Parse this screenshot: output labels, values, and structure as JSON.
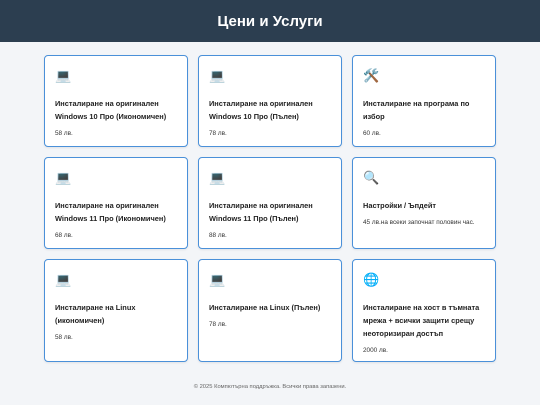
{
  "header": {
    "title": "Цени и Услуги"
  },
  "services": [
    {
      "icon": "laptop-icon",
      "glyph": "💻",
      "title": "Инсталиране на оригинален Windows 10 Про (Икономичен)",
      "price": "58 лв."
    },
    {
      "icon": "laptop-icon",
      "glyph": "💻",
      "title": "Инсталиране на оригинален Windows 10 Про (Пълен)",
      "price": "78 лв."
    },
    {
      "icon": "tools-icon",
      "glyph": "🛠️",
      "title": "Инсталиране на програма по избор",
      "price": "60 лв."
    },
    {
      "icon": "laptop-icon",
      "glyph": "💻",
      "title": "Инсталиране на оригинален Windows 11 Про (Икономичен)",
      "price": "68 лв."
    },
    {
      "icon": "laptop-icon",
      "glyph": "💻",
      "title": "Инсталиране на оригинален Windows 11 Про (Пълен)",
      "price": "88 лв."
    },
    {
      "icon": "magnifier-icon",
      "glyph": "🔍",
      "title": "Настройки / Ъпдейт",
      "price": "45 лв.на всеки започнат половин час."
    },
    {
      "icon": "laptop-icon",
      "glyph": "💻",
      "title": "Инсталиране на Linux (икономичен)",
      "price": "58 лв."
    },
    {
      "icon": "laptop-icon",
      "glyph": "💻",
      "title": "Инсталиране на Linux (Пълен)",
      "price": "78 лв."
    },
    {
      "icon": "globe-icon",
      "glyph": "🌐",
      "title": "Инсталиране на хост в тъмната мрежа + всички защити срещу неоторизиран достъп",
      "price": "2000 лв."
    }
  ],
  "footer": {
    "text": "© 2025 Компютърна поддръжка. Всички права запазени."
  },
  "colors": {
    "header_bg": "#2c3e50",
    "card_border": "#4a90d9",
    "page_bg": "#f3f5f8"
  }
}
